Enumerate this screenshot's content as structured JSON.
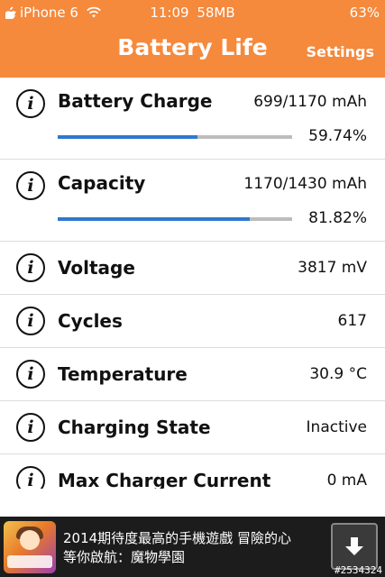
{
  "status_bar": {
    "carrier": "iPhone 6",
    "time": "11:09",
    "memory": "58MB",
    "battery": "63%"
  },
  "nav": {
    "title": "Battery Life",
    "settings_label": "Settings"
  },
  "colors": {
    "header": "#f5893c",
    "progress_fill": "#2f78cf",
    "progress_track": "#bdbdbd"
  },
  "rows": [
    {
      "label": "Battery Charge",
      "value": "699/1170 mAh",
      "percent": "59.74%",
      "progress": 0.5974
    },
    {
      "label": "Capacity",
      "value": "1170/1430 mAh",
      "percent": "81.82%",
      "progress": 0.8182
    },
    {
      "label": "Voltage",
      "value": "3817 mV"
    },
    {
      "label": "Cycles",
      "value": "617"
    },
    {
      "label": "Temperature",
      "value": "30.9 °C"
    },
    {
      "label": "Charging State",
      "value": "Inactive"
    },
    {
      "label": "Max Charger Current",
      "value": "0 mA"
    }
  ],
  "info_icon_glyph": "i",
  "ad": {
    "line1": "2014期待度最高的手機遊戲 冒險的心",
    "line2": "等你啟航：魔物學園",
    "id": "#2534324"
  }
}
